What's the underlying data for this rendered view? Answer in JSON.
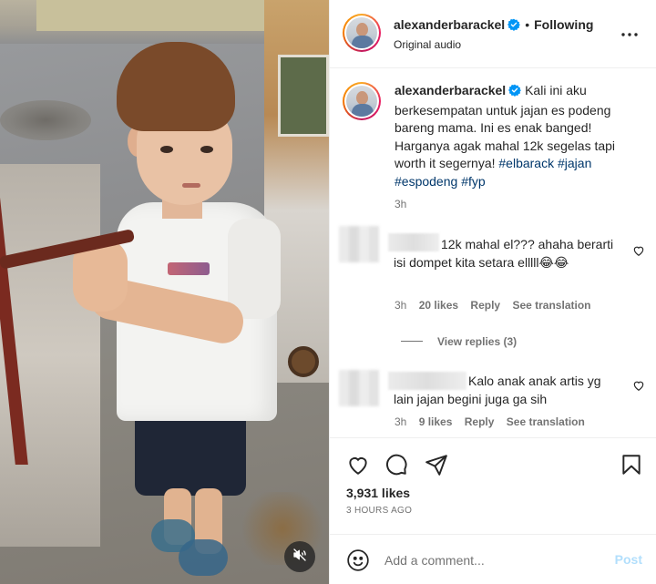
{
  "media": {
    "mute_icon": "speaker-muted-icon"
  },
  "header": {
    "username": "alexanderbarackel",
    "separator": "•",
    "follow_status": "Following",
    "audio": "Original audio",
    "more_icon": "more-horizontal-icon",
    "verified_color": "#0095f6"
  },
  "caption": {
    "username": "alexanderbarackel",
    "text": "Kali ini aku berkesempatan untuk jajan es podeng bareng mama. Ini es enak banged! Harganya agak mahal 12k segelas tapi worth it segernya!",
    "hashtags": [
      "#elbarack",
      "#jajan",
      "#espodeng",
      "#fyp"
    ],
    "time": "3h"
  },
  "comments": [
    {
      "text": "12k mahal el??? ahaha berarti isi dompet kita setara elllll😂😂",
      "time": "3h",
      "likes": "20 likes",
      "reply": "Reply",
      "translate": "See translation",
      "view_replies": "View replies (3)"
    },
    {
      "text": "Kalo anak anak artis yg lain jajan begini juga ga sih",
      "time": "3h",
      "likes": "9 likes",
      "reply": "Reply",
      "translate": "See translation"
    }
  ],
  "actions": {
    "likes": "3,931 likes",
    "timestamp": "3 HOURS AGO"
  },
  "add_comment": {
    "placeholder": "Add a comment...",
    "post": "Post",
    "post_color": "#b2dffc"
  }
}
